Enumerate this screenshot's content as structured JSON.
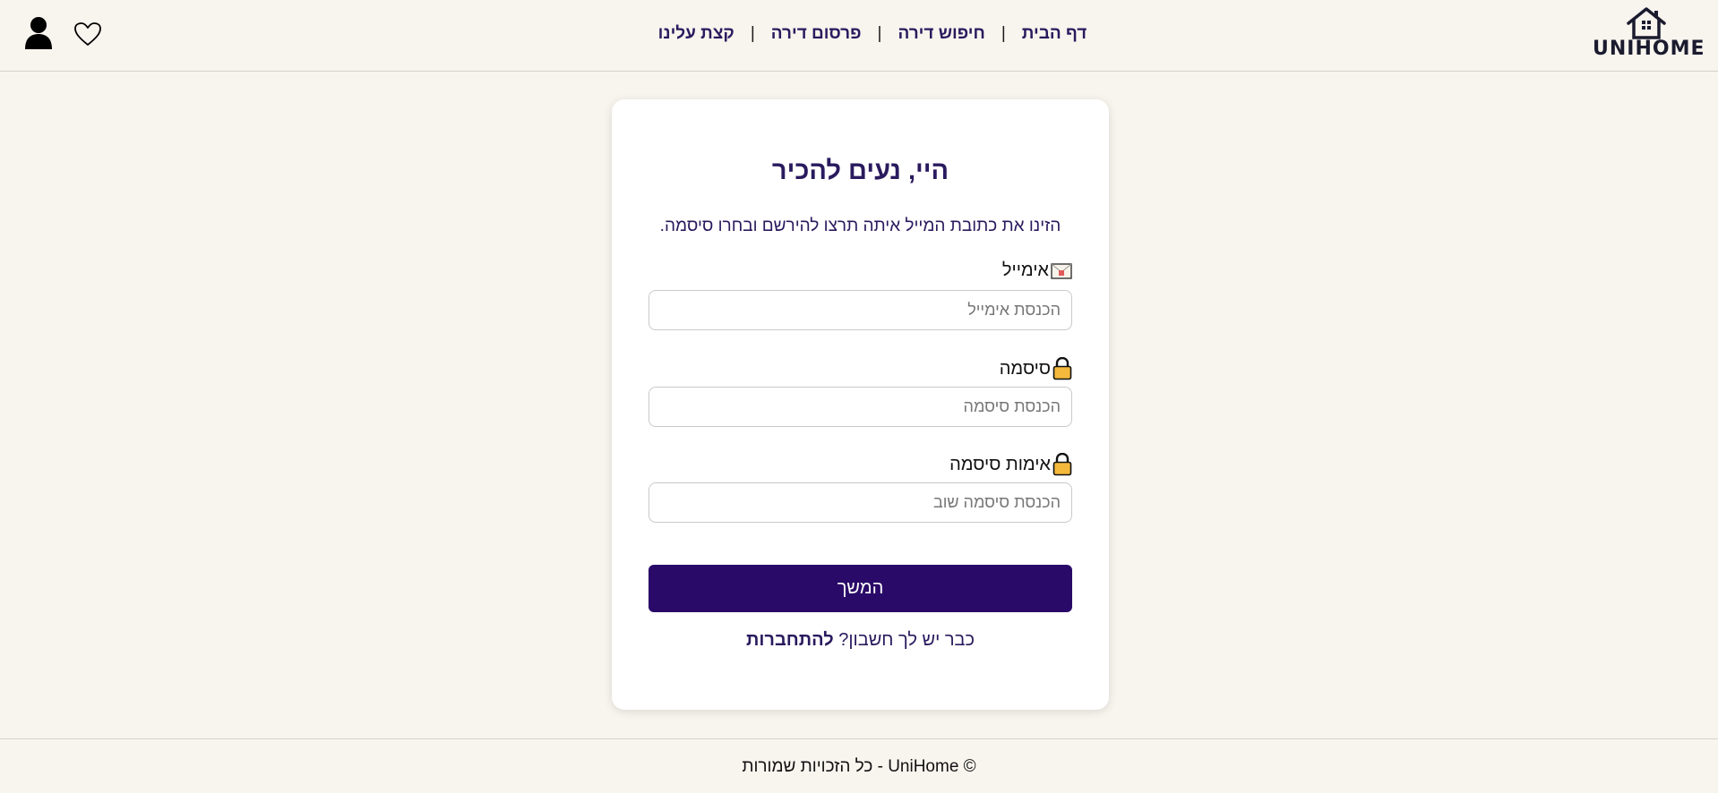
{
  "brand": {
    "name": "UNIHOME"
  },
  "nav": {
    "items": [
      "דף הבית",
      "חיפוש דירה",
      "פרסום דירה",
      "קצת עלינו"
    ],
    "separator": "|"
  },
  "icons": {
    "user": "user-icon",
    "heart": "heart-icon",
    "email": "envelope-icon",
    "lock": "lock-icon"
  },
  "form": {
    "title": "היי, נעים להכיר",
    "subtitle": "הזינו את כתובת המייל איתה תרצו להירשם ובחרו סיסמה.",
    "email": {
      "label": "אימייל",
      "placeholder": "הכנסת אימייל",
      "value": ""
    },
    "password": {
      "label": "סיסמה",
      "placeholder": "הכנסת סיסמה",
      "value": ""
    },
    "confirm": {
      "label": "אימות סיסמה",
      "placeholder": "הכנסת סיסמה שוב",
      "value": ""
    },
    "submit_label": "המשך",
    "login_prompt": "כבר יש לך חשבון?",
    "login_link": "להתחברות"
  },
  "footer": {
    "text": "© UniHome - כל הזכויות שמורות"
  },
  "colors": {
    "background": "#f8f4ee",
    "accent": "#2a0a68",
    "text_primary": "#2a1a5e",
    "card": "#ffffff"
  }
}
